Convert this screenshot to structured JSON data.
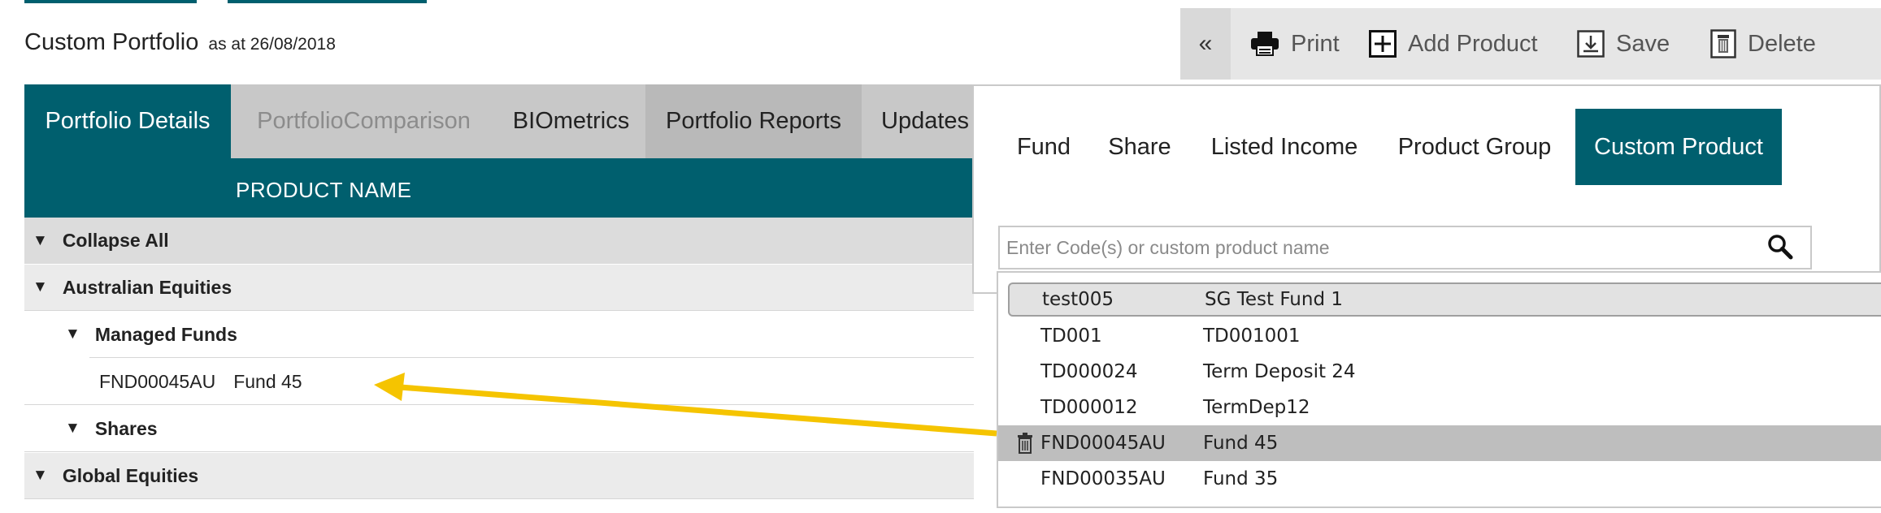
{
  "page": {
    "title": "Custom Portfolio",
    "as_at": "as at 26/08/2018"
  },
  "tabs": [
    {
      "label": "Portfolio Details",
      "state": "active"
    },
    {
      "label": "PortfolioComparison",
      "state": "disabled"
    },
    {
      "label": "BIOmetrics",
      "state": "normal"
    },
    {
      "label": "Portfolio Reports",
      "state": "normal"
    },
    {
      "label": "Updates",
      "state": "normal"
    }
  ],
  "table": {
    "column_header": "PRODUCT NAME",
    "rows": [
      {
        "label": "Collapse All",
        "level": 0
      },
      {
        "label": "Australian Equities",
        "level": 0
      },
      {
        "label": "Managed Funds",
        "level": 1
      },
      {
        "code": "FND00045AU",
        "name": "Fund 45",
        "level": 2
      },
      {
        "label": "Shares",
        "level": 1
      },
      {
        "label": "Global Equities",
        "level": 0
      }
    ],
    "expand_glyph": "▼"
  },
  "toolbar": {
    "collapse_label": "«",
    "print": "Print",
    "add_product": "Add Product",
    "save": "Save",
    "delete": "Delete"
  },
  "add_product_panel": {
    "tabs": [
      "Fund",
      "Share",
      "Listed Income",
      "Product Group",
      "Custom Product"
    ],
    "active_tab": "Custom Product",
    "search": {
      "placeholder": "Enter Code(s) or custom product name",
      "value": ""
    },
    "results": [
      {
        "code": "test005",
        "name": "SG Test Fund 1",
        "state": "hover"
      },
      {
        "code": "TD001",
        "name": "TD001001",
        "state": "normal"
      },
      {
        "code": "TD000024",
        "name": "Term Deposit 24",
        "state": "normal"
      },
      {
        "code": "TD000012",
        "name": "TermDep12",
        "state": "normal"
      },
      {
        "code": "FND00045AU",
        "name": "Fund 45",
        "state": "selected"
      },
      {
        "code": "FND00035AU",
        "name": "Fund 35",
        "state": "normal"
      }
    ]
  },
  "colors": {
    "brand_teal": "#005f6e",
    "annotation_arrow": "#f5c400"
  }
}
